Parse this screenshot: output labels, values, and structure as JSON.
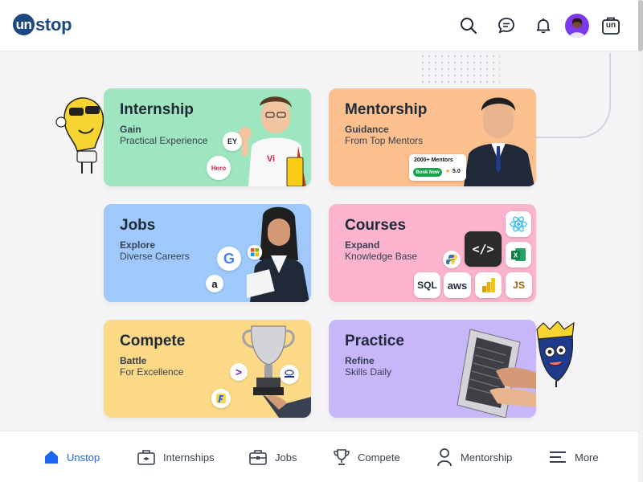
{
  "header": {
    "logo_badge": "un",
    "logo_text": "stop",
    "icons": [
      "search-icon",
      "chat-icon",
      "bell-icon",
      "avatar",
      "un-bag-icon"
    ],
    "bag_label": "un"
  },
  "cards": [
    {
      "title": "Internship",
      "line1": "Gain",
      "line2": "Practical Experience",
      "color": "#9ee6c0"
    },
    {
      "title": "Mentorship",
      "line1": "Guidance",
      "line2": "From Top Mentors",
      "color": "#fcc08e",
      "badge": {
        "count_text": "2000+ Mentors",
        "button": "Book Now",
        "rating": "5.0"
      }
    },
    {
      "title": "Jobs",
      "line1": "Explore",
      "line2": "Diverse Careers",
      "color": "#9ec9fa"
    },
    {
      "title": "Courses",
      "line1": "Expand",
      "line2": "Knowledge Base",
      "color": "#fcb3cd",
      "chips": {
        "code": "</>",
        "sql": "SQL",
        "aws": "aws",
        "js": "JS"
      }
    },
    {
      "title": "Compete",
      "line1": "Battle",
      "line2": "For Excellence",
      "color": "#fbd986"
    },
    {
      "title": "Practice",
      "line1": "Refine",
      "line2": "Skills Daily",
      "color": "#c8b6fb"
    }
  ],
  "internship_logos": {
    "ey": "EY",
    "vi": "Vi",
    "hero": "Hero"
  },
  "jobs_logos": {
    "google": "G",
    "amazon": "a"
  },
  "bottom_nav": [
    {
      "label": "Unstop",
      "icon": "home-icon",
      "active": true
    },
    {
      "label": "Internships",
      "icon": "internship-bag-icon",
      "active": false
    },
    {
      "label": "Jobs",
      "icon": "briefcase-icon",
      "active": false
    },
    {
      "label": "Compete",
      "icon": "trophy-icon",
      "active": false
    },
    {
      "label": "Mentorship",
      "icon": "person-icon",
      "active": false
    },
    {
      "label": "More",
      "icon": "menu-icon",
      "active": false
    }
  ],
  "colors": {
    "brand": "#1c4980",
    "accent": "#1c64f2"
  }
}
